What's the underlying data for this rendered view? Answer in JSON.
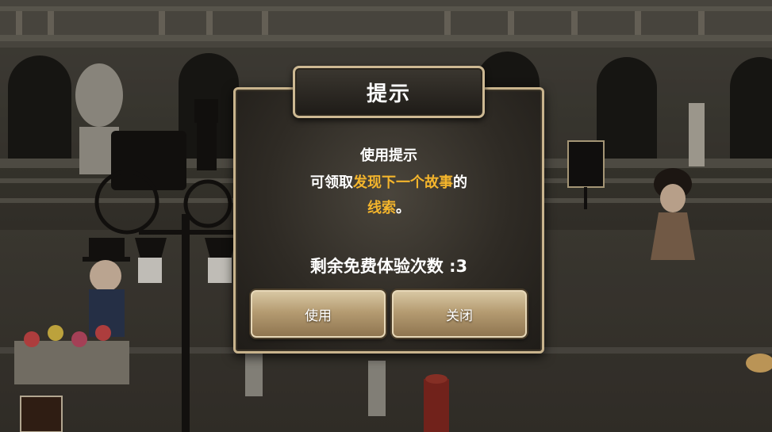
{
  "dialog": {
    "title": "提示",
    "line1": "使用提示",
    "line2_pre": "可领取",
    "line2_highlight": "发现下一个故事",
    "line2_post": "的",
    "line3_highlight": "线索",
    "line3_post": "。",
    "remaining": "剩余免费体验次数 :3",
    "use_button": "使用",
    "close_button": "关闭"
  },
  "colors": {
    "highlight": "#f4b52c",
    "frame": "#c9b48d",
    "button": "#b59c72"
  }
}
